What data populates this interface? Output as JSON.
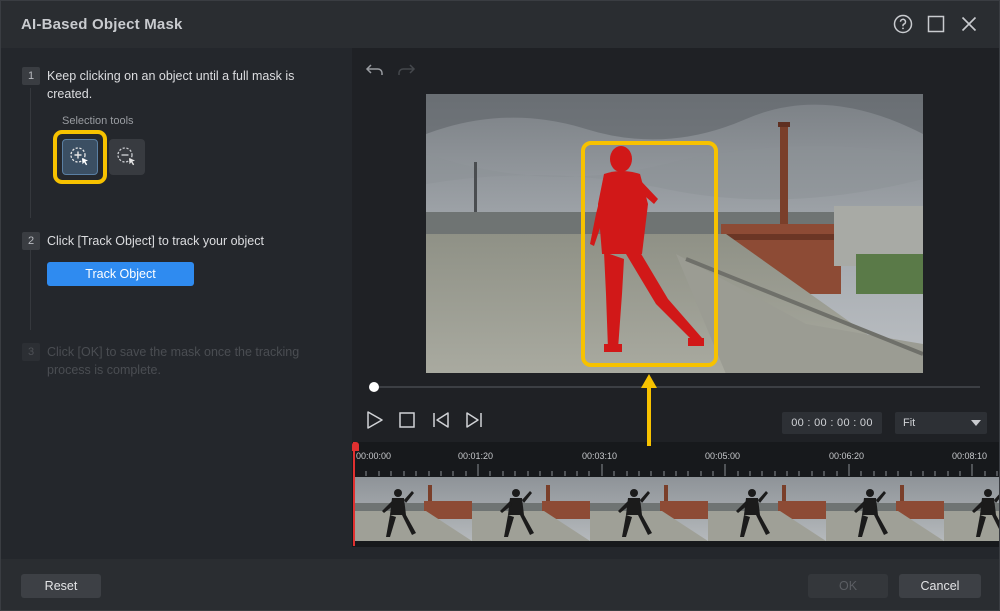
{
  "window": {
    "title": "AI-Based Object Mask"
  },
  "titlebar": {
    "help_icon": "help-circle-icon",
    "maximize_icon": "maximize-icon",
    "close_icon": "close-icon"
  },
  "steps": [
    {
      "num": "1",
      "text": "Keep clicking on an object until a full mask is created."
    },
    {
      "num": "2",
      "text": "Click [Track Object] to track your object"
    },
    {
      "num": "3",
      "text": "Click [OK] to save the mask once the tracking process is complete."
    }
  ],
  "selection_tools": {
    "label": "Selection tools",
    "tools": [
      {
        "icon": "add-selection-icon",
        "active": true
      },
      {
        "icon": "remove-selection-icon",
        "active": false
      }
    ]
  },
  "track_button": "Track Object",
  "player": {
    "timecode": "00 : 00 : 00 : 00",
    "zoom": "Fit",
    "progress": 0
  },
  "timeline": {
    "ticks": [
      "00:00:00",
      "00:01:20",
      "00:03:10",
      "00:05:00",
      "00:06:20",
      "00:08:10"
    ]
  },
  "footer": {
    "reset": "Reset",
    "ok": "OK",
    "cancel": "Cancel"
  },
  "colors": {
    "accent": "#2f8bf0",
    "highlight": "#f7c200",
    "mask": "#d11818",
    "playhead": "#e03030"
  }
}
